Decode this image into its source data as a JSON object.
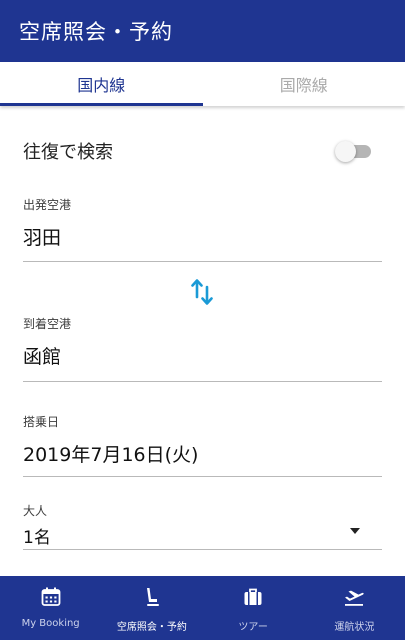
{
  "header": {
    "title": "空席照会・予約"
  },
  "tabs": [
    {
      "label": "国内線",
      "active": true
    },
    {
      "label": "国際線",
      "active": false
    }
  ],
  "round_trip": {
    "label": "往復で検索",
    "enabled": false
  },
  "departure": {
    "label": "出発空港",
    "value": "羽田"
  },
  "arrival": {
    "label": "到着空港",
    "value": "函館"
  },
  "date": {
    "label": "搭乗日",
    "value": "2019年7月16日(火)"
  },
  "passengers": {
    "label": "大人",
    "value": "1名"
  },
  "bottom_nav": [
    {
      "label": "My Booking",
      "icon": "calendar-icon"
    },
    {
      "label": "空席照会・予約",
      "icon": "seat-icon",
      "active": true
    },
    {
      "label": "ツアー",
      "icon": "suitcase-icon"
    },
    {
      "label": "運航状況",
      "icon": "plane-departure-icon"
    }
  ],
  "colors": {
    "primary": "#1f3591",
    "accent": "#1a9ad6"
  }
}
